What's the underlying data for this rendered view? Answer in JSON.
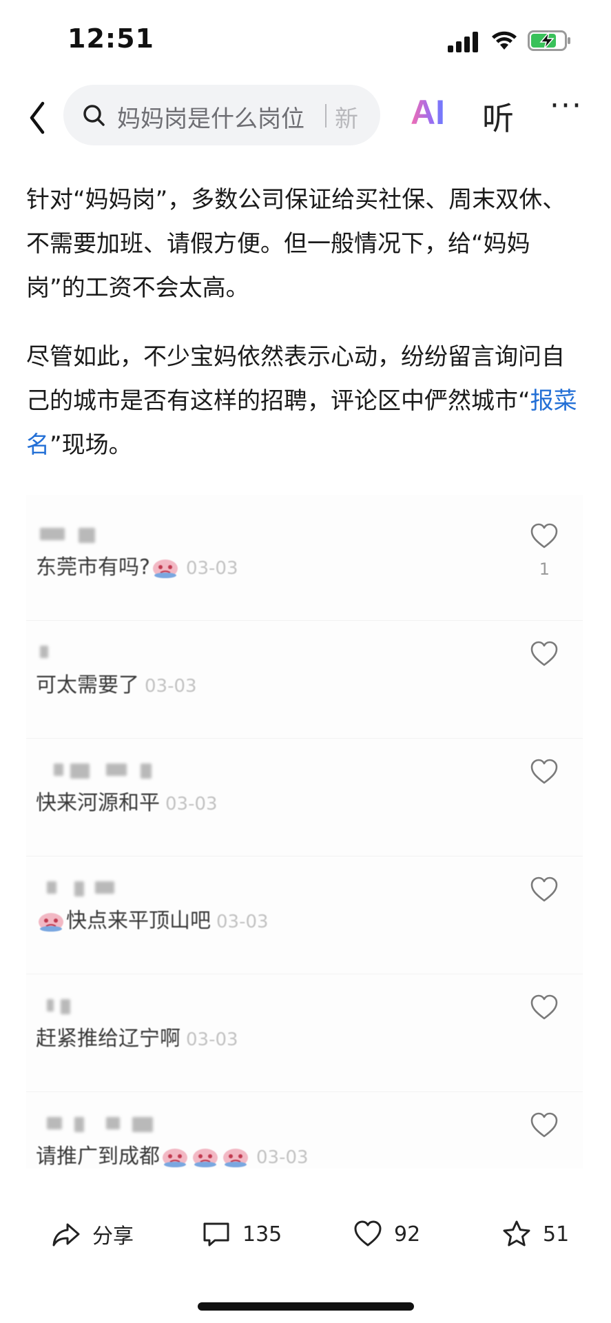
{
  "status_bar": {
    "time": "12:51",
    "icons": [
      "signal-icon",
      "wifi-icon",
      "battery-charging-icon"
    ]
  },
  "nav": {
    "search_text": "妈妈岗是什么岗位",
    "search_more": "新",
    "ai_label": "AI",
    "listen_label": "听",
    "more_label": "···",
    "icons": [
      "back-arrow-icon",
      "search-icon"
    ]
  },
  "article": {
    "paragraph_1": "针对“妈妈岗”，多数公司保证给买社保、周末双休、不需要加班、请假方便。但一般情况下，给“妈妈岗”的工资不会太高。",
    "paragraph_2_before": "尽管如此，不少宝妈依然表示心动，纷纷留言询问自己的城市是否有这样的招聘，评论区中俨然城市“",
    "paragraph_2_link": "报菜名",
    "paragraph_2_after": "”现场。"
  },
  "comments": [
    {
      "text": "东莞市有吗?",
      "emoji_count": 1,
      "emoji_position": "after",
      "date": "03-03",
      "likes": "1"
    },
    {
      "text": "可太需要了",
      "emoji_count": 0,
      "emoji_position": "after",
      "date": "03-03",
      "likes": ""
    },
    {
      "text": "快来河源和平",
      "emoji_count": 0,
      "emoji_position": "after",
      "date": "03-03",
      "likes": ""
    },
    {
      "text": "快点来平顶山吧",
      "emoji_count": 1,
      "emoji_position": "before",
      "date": "03-03",
      "likes": ""
    },
    {
      "text": "赶紧推给辽宁啊",
      "emoji_count": 0,
      "emoji_position": "after",
      "date": "03-03",
      "likes": ""
    },
    {
      "text": "请推广到成都",
      "emoji_count": 3,
      "emoji_position": "after",
      "date": "03-03",
      "likes": ""
    }
  ],
  "actions": {
    "share_label": "分享",
    "comment_count": "135",
    "like_count": "92",
    "favorite_count": "51",
    "icons": [
      "share-icon",
      "comment-icon",
      "heart-icon",
      "star-icon"
    ]
  },
  "colors": {
    "link": "#2470d6",
    "search_bg": "#f2f3f5",
    "ai_gradient_start": "#f36cb0",
    "ai_gradient_end": "#6a7cff",
    "battery_green": "#39c15a"
  }
}
